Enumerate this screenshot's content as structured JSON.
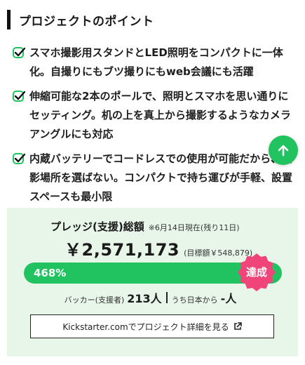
{
  "section_title": "プロジェクトのポイント",
  "points": [
    {
      "icon": "check-icon",
      "text": "スマホ撮影用スタンドとLED照明をコンパクトに一体化。自撮りにもブツ撮りにもweb会議にも活躍"
    },
    {
      "icon": "check-icon",
      "text": "伸縮可能な2本のポールで、照明とスマホを思い通りにセッティング。机の上を真上から撮影するようなカメラアングルにも対応"
    },
    {
      "icon": "check-icon",
      "text": "内蔵バッテリーでコードレスでの使用が可能だから、撮影場所を選ばない。コンパクトで持ち運びが手軽、設置スペースも最小限"
    }
  ],
  "scroll_top_icon": "arrow-up-icon",
  "pledge": {
    "title": "プレッジ(支援)総額",
    "note": "※6月14日現在(残り11日)",
    "amount": "￥2,571,173",
    "goal": "(目標額￥548,879)",
    "progress_label": "468%",
    "progress_fraction": 1.0,
    "badge": "達成",
    "backers_label": "バッカー(支援者)",
    "backers_count": "213人",
    "japan_label": "うち日本から",
    "japan_count": "-人"
  },
  "detail_button": {
    "label": "Kickstarter.comでプロジェクト詳細を見る",
    "icon": "external-link-icon"
  },
  "colors": {
    "accent": "#20c35f",
    "panel_bg": "#e8f6ea",
    "badge": "#f0457a",
    "track": "#d0d6d1"
  }
}
